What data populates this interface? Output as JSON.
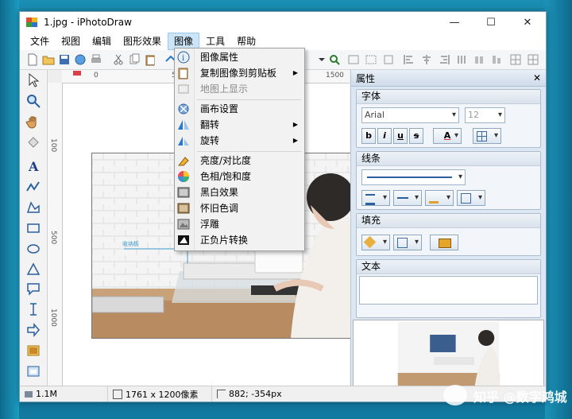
{
  "window": {
    "title": "1.jpg - iPhotoDraw",
    "controls": {
      "minimize": "—",
      "maximize": "☐",
      "close": "✕"
    }
  },
  "menubar": [
    "文件",
    "视图",
    "编辑",
    "图形效果",
    "图像",
    "工具",
    "帮助"
  ],
  "active_menu": "图像",
  "image_menu": {
    "items": [
      {
        "label": "图像属性",
        "icon": "info-icon",
        "submenu": false,
        "disabled": false
      },
      {
        "label": "复制图像到剪贴板",
        "icon": "clipboard-icon",
        "submenu": true,
        "disabled": false
      },
      {
        "label": "地图上显示",
        "icon": "map-icon",
        "submenu": false,
        "disabled": true
      },
      {
        "label": "画布设置",
        "icon": "canvas-icon",
        "submenu": false,
        "disabled": false
      },
      {
        "label": "翻转",
        "icon": "flip-icon",
        "submenu": true,
        "disabled": false
      },
      {
        "label": "旋转",
        "icon": "rotate-icon",
        "submenu": true,
        "disabled": false
      },
      {
        "label": "亮度/对比度",
        "icon": "brightness-icon",
        "submenu": false,
        "disabled": false
      },
      {
        "label": "色相/饱和度",
        "icon": "hue-icon",
        "submenu": false,
        "disabled": false
      },
      {
        "label": "黑白效果",
        "icon": "grayscale-icon",
        "submenu": false,
        "disabled": false
      },
      {
        "label": "怀旧色调",
        "icon": "sepia-icon",
        "submenu": false,
        "disabled": false
      },
      {
        "label": "浮雕",
        "icon": "emboss-icon",
        "submenu": false,
        "disabled": false
      },
      {
        "label": "正负片转换",
        "icon": "invert-icon",
        "submenu": false,
        "disabled": false
      }
    ]
  },
  "rulers": {
    "top": [
      "0",
      "500",
      "1500"
    ],
    "left": [
      "100",
      "500",
      "1000"
    ]
  },
  "photo": {
    "annotation_label": "收纳板"
  },
  "properties_panel": {
    "title": "属性",
    "close": "✕",
    "font_group": {
      "title": "字体",
      "font_name": "Arial",
      "font_size": "12",
      "style_buttons": [
        "b",
        "i",
        "u",
        "s"
      ],
      "color_button": "A"
    },
    "line_group": {
      "title": "线条"
    },
    "fill_group": {
      "title": "填充"
    },
    "text_group": {
      "title": "文本"
    }
  },
  "statusbar": {
    "file_size": "1.1M",
    "dimensions": "1761 x 1200像素",
    "coordinates": "882; -354px"
  },
  "watermark": "知乎 @数字鸿城",
  "colors": {
    "menu_highlight": "#cce4f7",
    "panel_bg": "#dce7f3"
  }
}
